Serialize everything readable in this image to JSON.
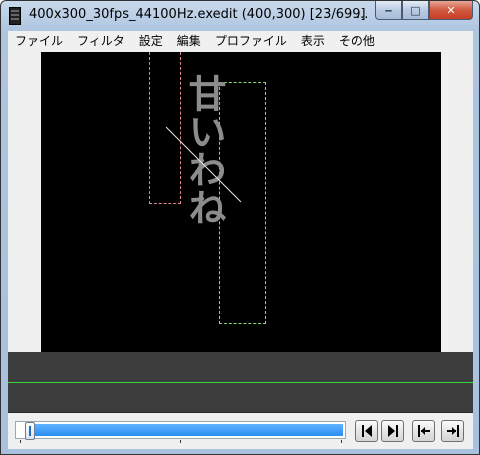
{
  "window": {
    "title": "400x300_30fps_44100Hz.exedit (400,300)  [23/699]",
    "title_ellipsis": "...",
    "minimize_glyph": "‒",
    "maximize_glyph": "□",
    "close_glyph": "✕"
  },
  "menu": {
    "items": [
      "ファイル",
      "フィルタ",
      "設定",
      "編集",
      "プロファイル",
      "表示",
      "その他"
    ]
  },
  "preview": {
    "text": "甘いわね",
    "text_color": "#8c8c8c",
    "background": "#000000"
  },
  "timeline": {
    "line_color": "#38d838"
  },
  "seek": {
    "fill_color": "#2a8ef0",
    "current_frame": 23,
    "total_frames": 699
  },
  "icons": {
    "prev_frame": "step-back-icon",
    "next_frame": "step-forward-icon",
    "first_frame": "skip-to-start-icon",
    "last_frame": "skip-to-end-icon"
  }
}
